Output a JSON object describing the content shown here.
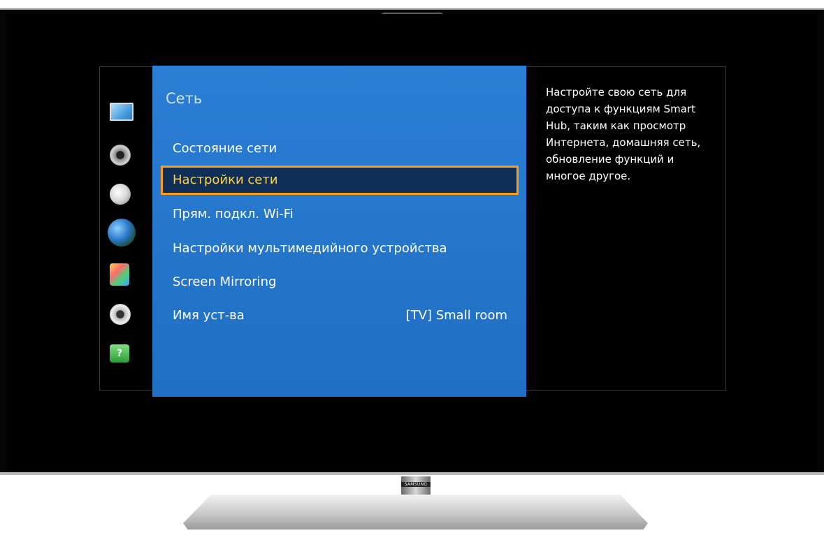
{
  "panel": {
    "title": "Сеть"
  },
  "menu": [
    {
      "label": "Состояние сети",
      "value": ""
    },
    {
      "label": "Настройки сети",
      "value": ""
    },
    {
      "label": "Прям. подкл. Wi-Fi",
      "value": ""
    },
    {
      "label": "Настройки мультимедийного устройства",
      "value": ""
    },
    {
      "label": "Screen Mirroring",
      "value": ""
    },
    {
      "label": "Имя уст-ва",
      "value": "[TV] Small room"
    }
  ],
  "selected_index": 1,
  "description": "Настройте свою сеть для доступа к функциям Smart Hub, таким как просмотр Интернета, домашняя сеть, обновление функций и многое другое.",
  "categories": [
    {
      "icon": "picture-icon"
    },
    {
      "icon": "sound-icon"
    },
    {
      "icon": "broadcast-icon"
    },
    {
      "icon": "network-globe-icon"
    },
    {
      "icon": "smart-features-icon"
    },
    {
      "icon": "system-gear-icon"
    },
    {
      "icon": "support-help-icon",
      "glyph": "?"
    }
  ],
  "brand": "SAMSUNG",
  "colors": {
    "panel_blue": "#2277cc",
    "highlight_border": "#ff9a1f",
    "highlight_text": "#ffd24a"
  }
}
